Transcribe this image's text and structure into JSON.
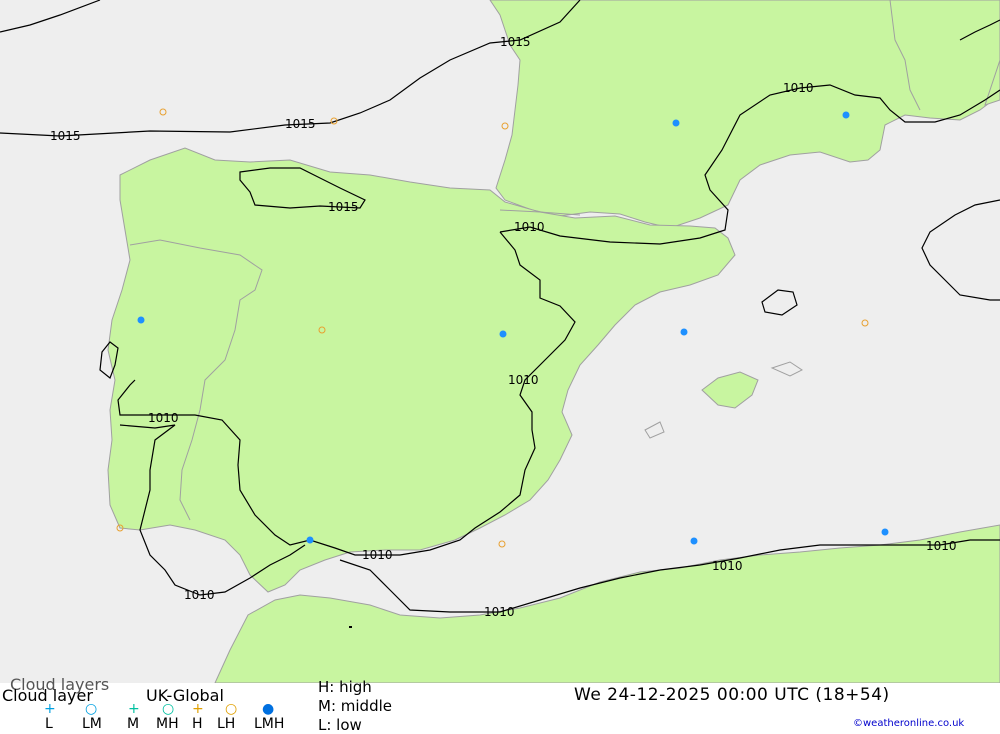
{
  "legend": {
    "title_top": "Cloud layers",
    "title_main": "Cloud layer",
    "model": "UK-Global",
    "key_high": "H: high",
    "key_middle": "M: middle",
    "key_low": "L: low",
    "datetime": "We 24-12-2025 00:00 UTC (18+54)",
    "credit": "©weatheronline.co.uk",
    "symbols": [
      {
        "abbr": "L",
        "glyph": "+",
        "color": "#00a0e0"
      },
      {
        "abbr": "LM",
        "glyph": "○",
        "color": "#00a0e0"
      },
      {
        "abbr": "M",
        "glyph": "+",
        "color": "#00c0a0"
      },
      {
        "abbr": "MH",
        "glyph": "○",
        "color": "#00c0a0"
      },
      {
        "abbr": "H",
        "glyph": "+",
        "color": "#e0a000"
      },
      {
        "abbr": "LH",
        "glyph": "○",
        "color": "#e0a000"
      },
      {
        "abbr": "LMH",
        "glyph": "●",
        "color": "#0070e0"
      }
    ]
  },
  "isobars": {
    "labels": [
      "1015",
      "1015",
      "1015",
      "1015",
      "1010",
      "1010",
      "1010",
      "1010",
      "1010",
      "1010",
      "1010",
      "1010",
      "1010"
    ]
  },
  "colors": {
    "sea": "#eeeeee",
    "land": "#c8f5a0",
    "coast": "#a0a0a0",
    "isobar": "#000000",
    "lmh_marker": "#1e90ff",
    "high_marker": "#e8a030"
  }
}
